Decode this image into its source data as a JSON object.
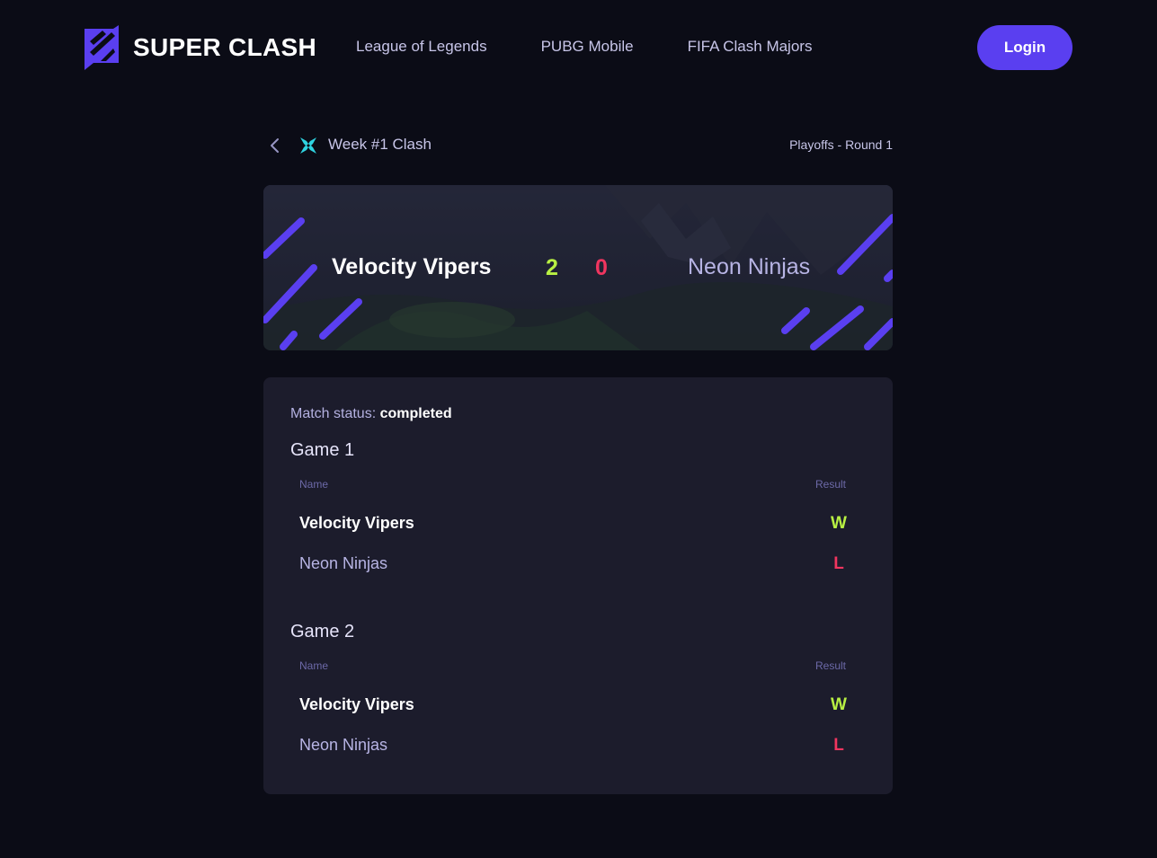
{
  "header": {
    "brand": "SUPER CLASH",
    "logo_icon": "super-clash-logo",
    "nav": [
      "League of Legends",
      "PUBG Mobile",
      "FIFA Clash Majors"
    ],
    "login_label": "Login"
  },
  "breadcrumb": {
    "back_icon": "chevron-left-icon",
    "game_icon": "mobile-legends-logo",
    "title": "Week #1 Clash",
    "round": "Playoffs - Round 1"
  },
  "match": {
    "home_team": "Velocity Vipers",
    "home_score": "2",
    "away_score": "0",
    "away_team": "Neon Ninjas"
  },
  "details": {
    "status_label": "Match status:",
    "status_value": "completed",
    "games": [
      {
        "title": "Game 1",
        "col_name": "Name",
        "col_result": "Result",
        "rows": [
          {
            "name": "Velocity Vipers",
            "result": "W"
          },
          {
            "name": "Neon Ninjas",
            "result": "L"
          }
        ]
      },
      {
        "title": "Game 2",
        "col_name": "Name",
        "col_result": "Result",
        "rows": [
          {
            "name": "Velocity Vipers",
            "result": "W"
          },
          {
            "name": "Neon Ninjas",
            "result": "L"
          }
        ]
      }
    ]
  },
  "colors": {
    "background": "#0b0c16",
    "card": "#1c1c2c",
    "accent": "#5a3ff0",
    "win": "#b8f043",
    "loss": "#f0355f",
    "muted_text": "#c7c5e8"
  }
}
